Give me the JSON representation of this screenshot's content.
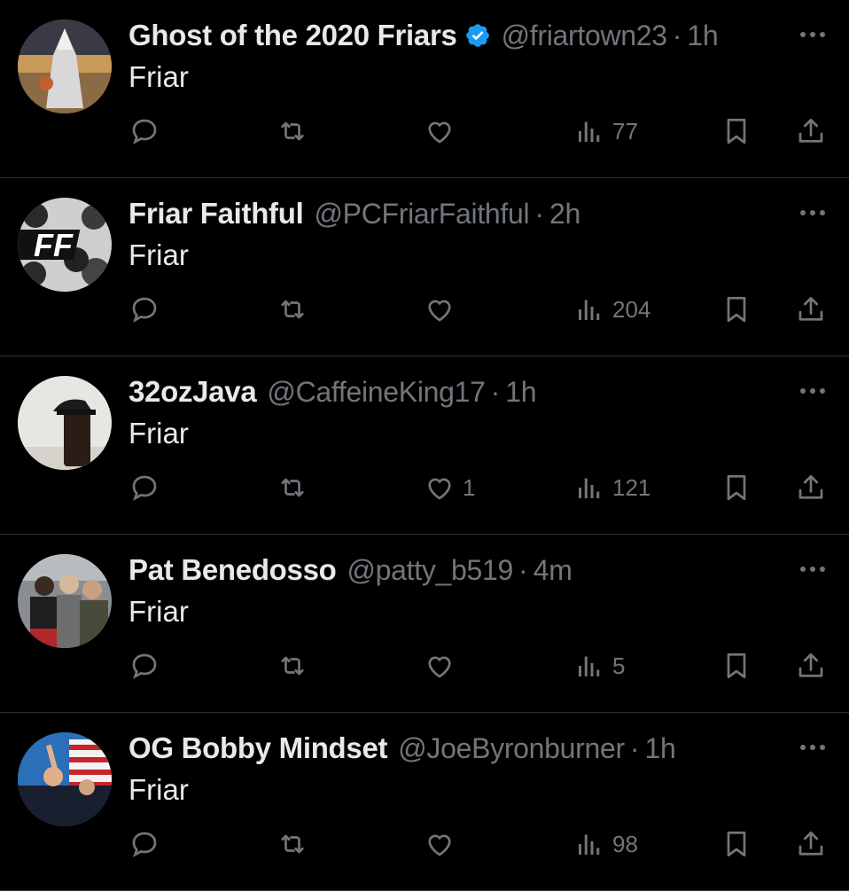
{
  "colors": {
    "background": "#000000",
    "text": "#e7e9ea",
    "muted": "#71767b",
    "verified": "#1d9bf0",
    "divider": "#2f3336"
  },
  "tweets": [
    {
      "name": "Ghost of the 2020 Friars",
      "verified": true,
      "handle": "@friartown23",
      "separator": "·",
      "time": "1h",
      "text": "Friar",
      "replies": "",
      "retweets": "",
      "likes": "",
      "views": "77",
      "avatar_icon": "hooded-figure-avatar"
    },
    {
      "name": "Friar Faithful",
      "verified": false,
      "handle": "@PCFriarFaithful",
      "separator": "·",
      "time": "2h",
      "text": "Friar",
      "replies": "",
      "retweets": "",
      "likes": "",
      "views": "204",
      "avatar_icon": "ff-logo-avatar",
      "avatar_text": "FF"
    },
    {
      "name": "32ozJava",
      "verified": false,
      "handle": "@CaffeineKing17",
      "separator": "·",
      "time": "1h",
      "text": "Friar",
      "replies": "",
      "retweets": "",
      "likes": "1",
      "views": "121",
      "avatar_icon": "coffee-cup-avatar"
    },
    {
      "name": "Pat Benedosso",
      "verified": false,
      "handle": "@patty_b519",
      "separator": "·",
      "time": "4m",
      "text": "Friar",
      "replies": "",
      "retweets": "",
      "likes": "",
      "views": "5",
      "avatar_icon": "group-photo-avatar"
    },
    {
      "name": "OG Bobby Mindset",
      "verified": false,
      "handle": "@JoeByronburner",
      "separator": "·",
      "time": "1h",
      "text": "Friar",
      "replies": "",
      "retweets": "",
      "likes": "",
      "views": "98",
      "avatar_icon": "flag-photo-avatar"
    }
  ]
}
